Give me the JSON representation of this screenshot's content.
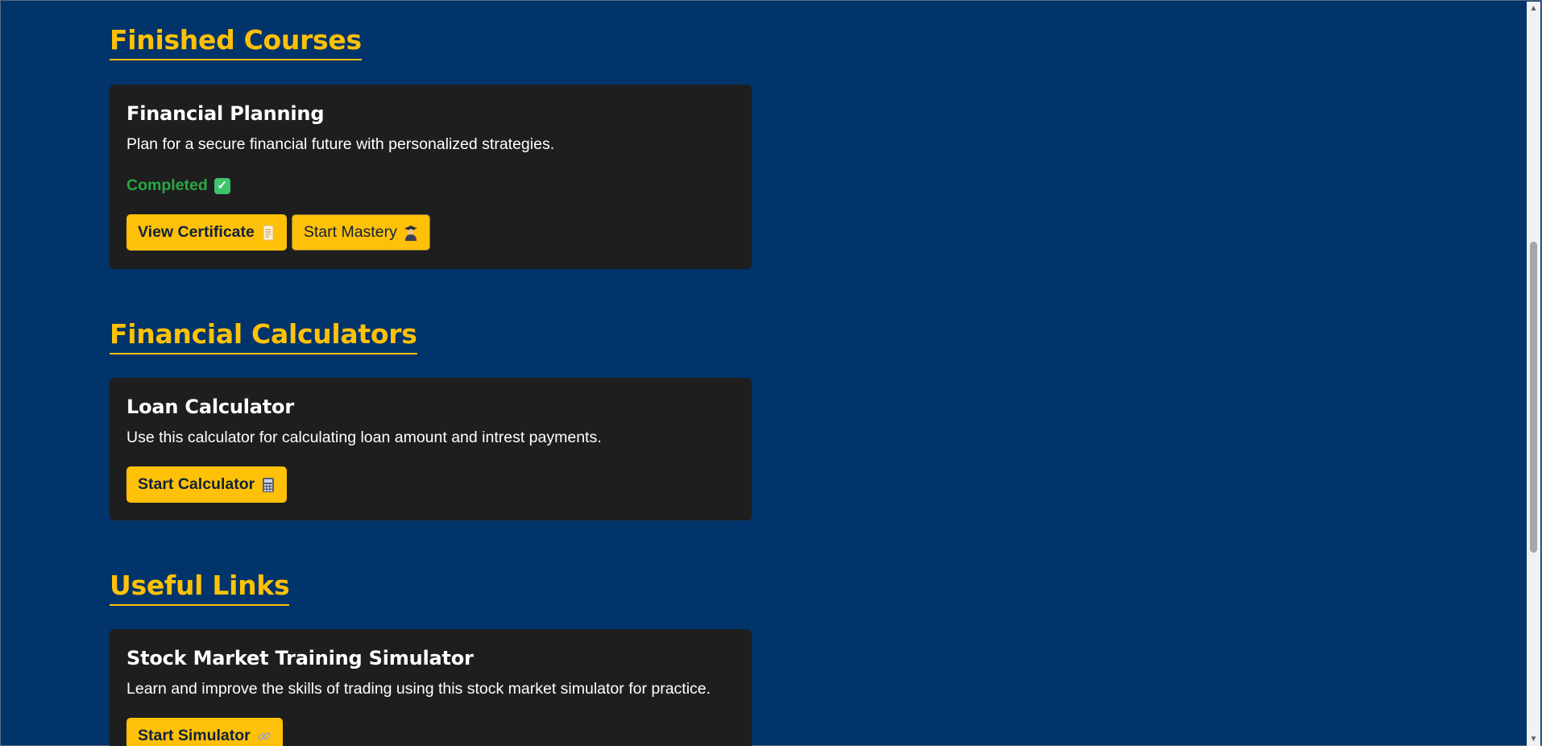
{
  "colors": {
    "background": "#00346a",
    "accent": "#ffc107",
    "card": "#1e1e1e",
    "success": "#28a745"
  },
  "sections": {
    "finished": {
      "title": "Finished Courses",
      "card": {
        "title": "Financial Planning",
        "description": "Plan for a secure financial future with personalized strategies.",
        "status": "Completed",
        "status_icon": "check-mark-icon",
        "buttons": {
          "certificate": {
            "label": "View Certificate",
            "icon": "scroll-icon"
          },
          "mastery": {
            "label": "Start Mastery",
            "icon": "graduate-icon"
          }
        }
      }
    },
    "calculators": {
      "title": "Financial Calculators",
      "card": {
        "title": "Loan Calculator",
        "description": "Use this calculator for calculating loan amount and intrest payments.",
        "button": {
          "label": "Start Calculator",
          "icon": "calculator-icon"
        }
      }
    },
    "links": {
      "title": "Useful Links",
      "card": {
        "title": "Stock Market Training Simulator",
        "description": "Learn and improve the skills of trading using this stock market simulator for practice.",
        "button": {
          "label": "Start Simulator",
          "icon": "link-icon"
        }
      }
    }
  }
}
